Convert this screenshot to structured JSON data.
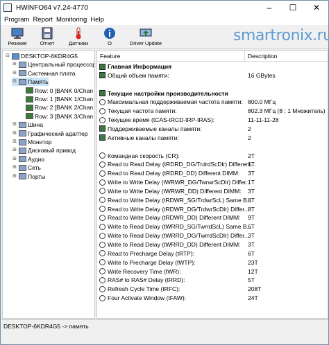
{
  "window": {
    "title": "HWiNFO64 v7.24-4770",
    "min": "–",
    "max": "☐",
    "close": "✕"
  },
  "menu": [
    "Program",
    "Report",
    "Monitoring",
    "Help"
  ],
  "toolbar": [
    {
      "label": "Резюме",
      "icon": "monitor-icon"
    },
    {
      "label": "Отчет",
      "icon": "save-icon"
    },
    {
      "label": "Датчики",
      "icon": "thermometer-icon"
    },
    {
      "label": "О",
      "icon": "info-icon"
    },
    {
      "label": "Driver Update",
      "icon": "driver-update-icon"
    }
  ],
  "brand": "smartronix.ru",
  "tree": [
    {
      "label": "DESKTOP-6KDR4G5",
      "exp": "⊟",
      "level": 0
    },
    {
      "label": "Центральный процессор",
      "exp": "⊞",
      "level": 1
    },
    {
      "label": "Системная плата",
      "exp": "⊞",
      "level": 1
    },
    {
      "label": "Память",
      "exp": "⊟",
      "level": 1,
      "selected": true
    },
    {
      "label": "Row: 0 [BANK 0/Chan",
      "exp": "",
      "level": 2
    },
    {
      "label": "Row: 1 [BANK 1/Chan",
      "exp": "",
      "level": 2
    },
    {
      "label": "Row: 2 [BANK 2/Chan",
      "exp": "",
      "level": 2
    },
    {
      "label": "Row: 3 [BANK 3/Chan",
      "exp": "",
      "level": 2
    },
    {
      "label": "Шина",
      "exp": "⊞",
      "level": 1
    },
    {
      "label": "Графический адаптер",
      "exp": "⊞",
      "level": 1
    },
    {
      "label": "Монитор",
      "exp": "⊞",
      "level": 1
    },
    {
      "label": "Дисковый привод",
      "exp": "⊞",
      "level": 1
    },
    {
      "label": "Аудио",
      "exp": "⊞",
      "level": 1
    },
    {
      "label": "Сеть",
      "exp": "⊞",
      "level": 1
    },
    {
      "label": "Порты",
      "exp": "⊞",
      "level": 1
    }
  ],
  "columns": {
    "feature": "Feature",
    "description": "Description"
  },
  "rows": [
    {
      "f": "Главная Информация",
      "v": "",
      "icon": "chip",
      "section": true
    },
    {
      "f": "Общий объем памяти:",
      "v": "16 GBytes",
      "icon": "chip"
    },
    {
      "f": "",
      "v": ""
    },
    {
      "f": "Текущие настройки производительности",
      "v": "",
      "icon": "chip",
      "section": true
    },
    {
      "f": "Максимальная поддерживаемая частота памяти:",
      "v": "800.0 МГц",
      "icon": "ring"
    },
    {
      "f": "Текущая частота памяти:",
      "v": "802.3 МГц (8 : 1 Множитель)",
      "icon": "ring"
    },
    {
      "f": "Текущее время (tCAS-tRCD-tRP-tRAS):",
      "v": "11-11-11-28",
      "icon": "ring"
    },
    {
      "f": "Поддерживаемые каналы памяти:",
      "v": "2",
      "icon": "chip"
    },
    {
      "f": "Активные каналы памяти:",
      "v": "2",
      "icon": "chip"
    },
    {
      "f": "",
      "v": ""
    },
    {
      "f": "Командная скорость (CR):",
      "v": "2T",
      "icon": "ring"
    },
    {
      "f": "Read to Read Delay (tRDRD_DG/TrdrdScDlr) Different...",
      "v": "1T",
      "icon": "ring"
    },
    {
      "f": "Read to Read Delay (tRDRD_DD) Different DIMM:",
      "v": "3T",
      "icon": "ring"
    },
    {
      "f": "Write to Write Delay (tWRWR_DG/TwrwrScDlr) Differ...",
      "v": "1T",
      "icon": "ring"
    },
    {
      "f": "Write to Write Delay (tWRWR_DD) Different DIMM:",
      "v": "3T",
      "icon": "ring"
    },
    {
      "f": "Read to Write Delay (tRDWR_SG/TrdwrScL) Same B...",
      "v": "8T",
      "icon": "ring"
    },
    {
      "f": "Read to Write Delay (tRDWR_DG/TrdwrScDlr) Differ...",
      "v": "8T",
      "icon": "ring"
    },
    {
      "f": "Read to Write Delay (tRDWR_DD) Different DIMM:",
      "v": "9T",
      "icon": "ring"
    },
    {
      "f": "Write to Read Delay (tWRRD_SG/TwrrdScL) Same B...",
      "v": "6T",
      "icon": "ring"
    },
    {
      "f": "Write to Read Delay (tWRRD_DG/TwrrdScDlr) Differ...",
      "v": "3T",
      "icon": "ring"
    },
    {
      "f": "Write to Read Delay (tWRRD_DD) Different DIMM:",
      "v": "3T",
      "icon": "ring"
    },
    {
      "f": "Read to Precharge Delay (tRTP):",
      "v": "6T",
      "icon": "ring"
    },
    {
      "f": "Write to Precharge Delay (tWTP):",
      "v": "23T",
      "icon": "ring"
    },
    {
      "f": "Write Recovery Time (tWR):",
      "v": "12T",
      "icon": "ring"
    },
    {
      "f": "RAS# to RAS# Delay (tRRD):",
      "v": "5T",
      "icon": "ring"
    },
    {
      "f": "Refresh Cycle Time (tRFC):",
      "v": "208T",
      "icon": "ring"
    },
    {
      "f": "Four Activate Window (tFAW):",
      "v": "24T",
      "icon": "ring"
    }
  ],
  "status": "DESKTOP-6KDR4G5 -> память"
}
